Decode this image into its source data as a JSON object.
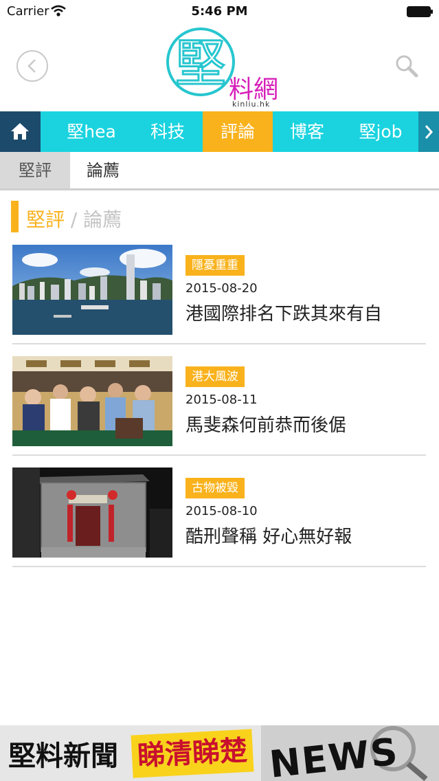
{
  "status_bar": {
    "carrier": "Carrier",
    "time": "5:46 PM"
  },
  "header": {
    "logo_main": "堅",
    "logo_sub": "料網",
    "logo_domain": "kinliu.hk"
  },
  "nav": {
    "tabs": [
      {
        "label": "堅hea",
        "active": false
      },
      {
        "label": "科技",
        "active": false
      },
      {
        "label": "評論",
        "active": true
      },
      {
        "label": "博客",
        "active": false
      },
      {
        "label": "堅job",
        "active": false
      }
    ]
  },
  "sub_nav": {
    "section": "堅評",
    "current": "論薦"
  },
  "heading": {
    "primary": "堅評",
    "separator": " / ",
    "secondary": "論薦"
  },
  "articles": [
    {
      "tag": "隱憂重重",
      "date": "2015-08-20",
      "title": "港國際排名下跌其來有自"
    },
    {
      "tag": "港大風波",
      "date": "2015-08-11",
      "title": "馬斐森何前恭而後倨"
    },
    {
      "tag": "古物被毀",
      "date": "2015-08-10",
      "title": "酷刑聲稱 好心無好報"
    }
  ],
  "banner": {
    "text_1": "堅料新聞",
    "text_2": "睇清睇楚",
    "text_3": "NEWS"
  },
  "colors": {
    "accent": "#f9b21c",
    "nav_bg": "#1ad3df",
    "home_bg": "#1c4a6b",
    "logo_cyan": "#27c6cf",
    "logo_magenta": "#d61fb9"
  }
}
